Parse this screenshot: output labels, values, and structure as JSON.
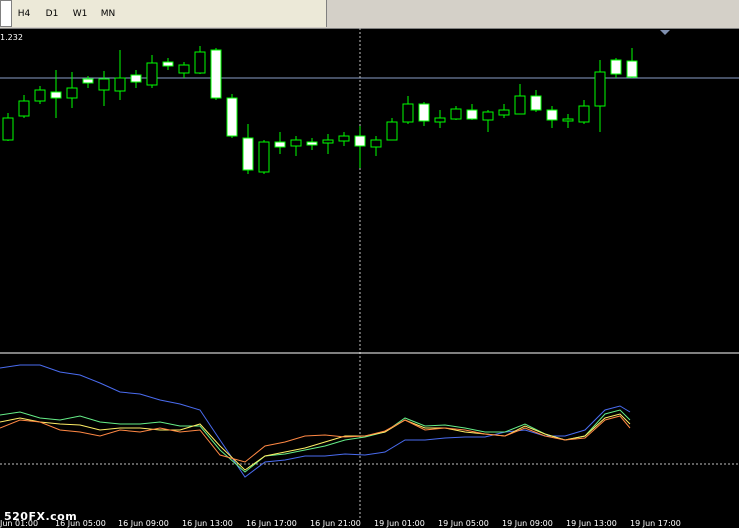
{
  "toolbar": {
    "timeframes": [
      "H4",
      "D1",
      "W1",
      "MN"
    ]
  },
  "price": {
    "top_label": "1.232"
  },
  "watermark": "520FX.com",
  "time_axis": [
    "Jun 01:00",
    "16 Jun 05:00",
    "16 Jun 09:00",
    "16 Jun 13:00",
    "16 Jun 17:00",
    "16 Jun 21:00",
    "19 Jun 01:00",
    "19 Jun 05:00",
    "19 Jun 09:00",
    "19 Jun 13:00",
    "19 Jun 17:00"
  ],
  "colors": {
    "background": "#000000",
    "bull_body": "#ffffff",
    "wick": "#00ff00",
    "separator": "#ffffff",
    "crosshair": "#c0c0c0",
    "horizontal_line": "#8a9ec8",
    "line_blue": "#4a6cf0",
    "line_green": "#66ee88",
    "line_yellow": "#ffee66",
    "line_orange": "#ff8844"
  }
}
